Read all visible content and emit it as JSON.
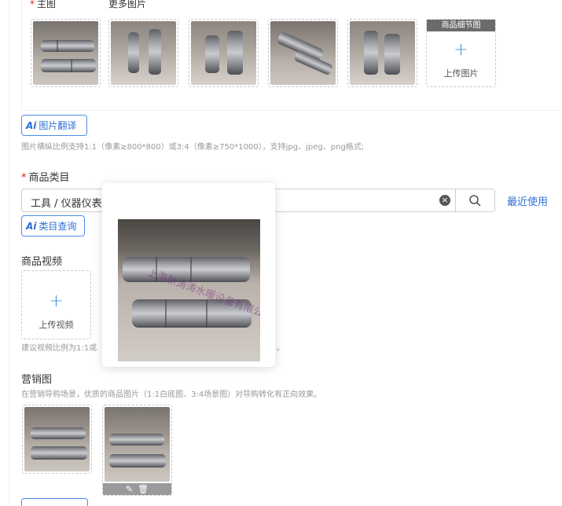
{
  "main_image": {
    "label": "主图",
    "more_label": "更多图片",
    "detail_header": "商品细节图",
    "upload_label": "上传图片",
    "watermark": "上海新涛涛水暖设备有限公司"
  },
  "ai_translate": {
    "ai": "Ai",
    "label": "图片翻译"
  },
  "image_hint": "图片横纵比例支持1:1（像素≥800*800）或3:4（像素≥750*1000），支持jpg、jpeg、png格式;",
  "category": {
    "label": "商品类目",
    "value": "工具 / 仪器仪表 /",
    "recent_label": "最近使用",
    "ai_query_label": "类目查询"
  },
  "video": {
    "label": "商品视频",
    "upload_label": "上传视频",
    "hint_left": "建议视频比例为1:1或",
    "hint_right": "。"
  },
  "marketing": {
    "label": "营销图",
    "hint": "在营销导购场景，优质的商品图片（1:1白底图、3:4场景图）对导购转化有正向效果。"
  },
  "icons": {
    "plus": "+",
    "clear": "×",
    "edit": "✎",
    "delete": "🗑"
  },
  "colors": {
    "accent": "#2f6fd6",
    "required": "#e02020"
  }
}
